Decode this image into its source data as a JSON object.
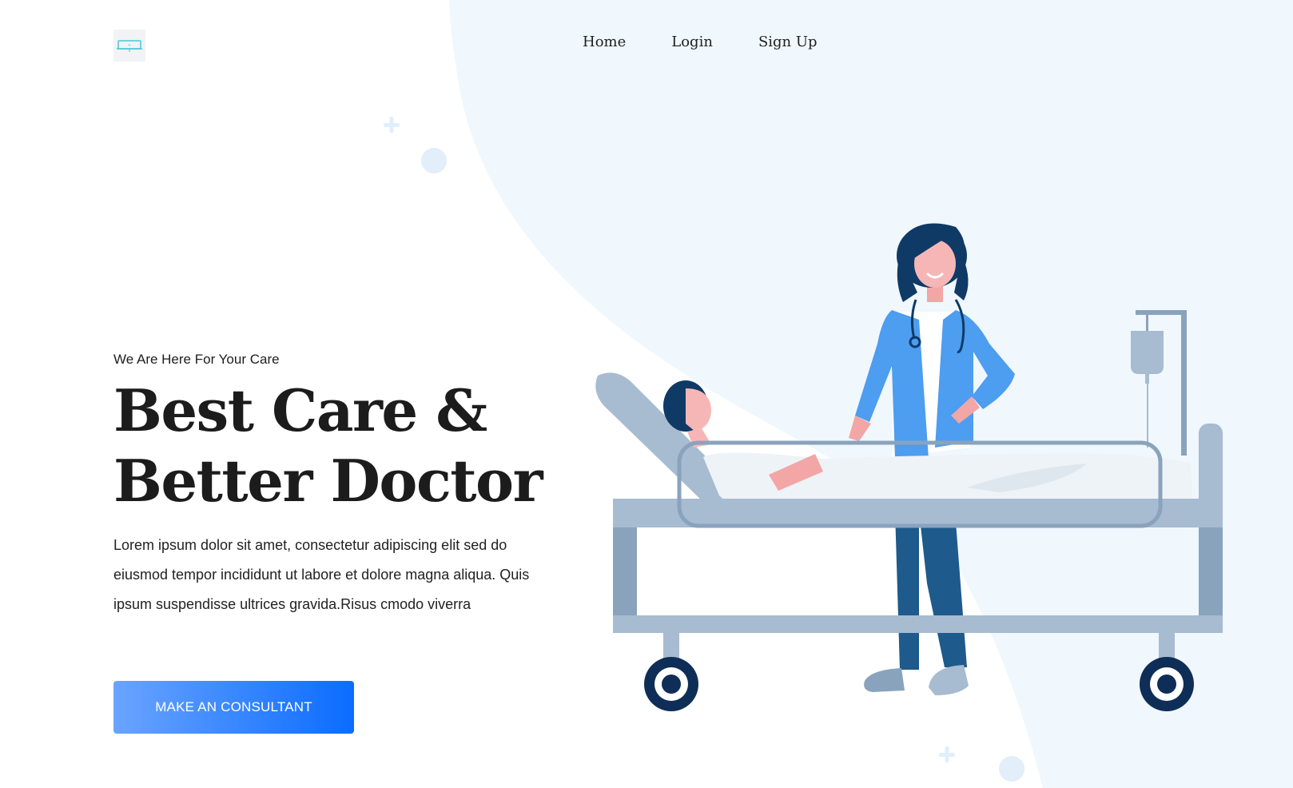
{
  "colors": {
    "background": "#ffffff",
    "bg_shape": "#f0f7fd",
    "button_gradient_start": "#6aa4ff",
    "button_gradient_end": "#0a6cff",
    "text_dark": "#1c1c1c",
    "accent_teal": "#4cc6d9"
  },
  "header": {
    "logo_icon": "medical-logo-icon",
    "nav": [
      {
        "label": "Home"
      },
      {
        "label": "Login"
      },
      {
        "label": "Sign Up"
      }
    ]
  },
  "hero": {
    "eyebrow": "We Are Here For Your Care",
    "headline_line1": "Best Care &",
    "headline_line2": "Better Doctor",
    "description": "Lorem ipsum dolor sit amet, consectetur adipiscing elit sed do eiusmod tempor incididunt ut labore et dolore magna aliqua. Quis ipsum suspendisse ultrices gravida.Risus cmodo viverra",
    "cta_label": "MAKE AN CONSULTANT"
  },
  "illustration": {
    "name": "doctor-patient-bed-illustration"
  }
}
